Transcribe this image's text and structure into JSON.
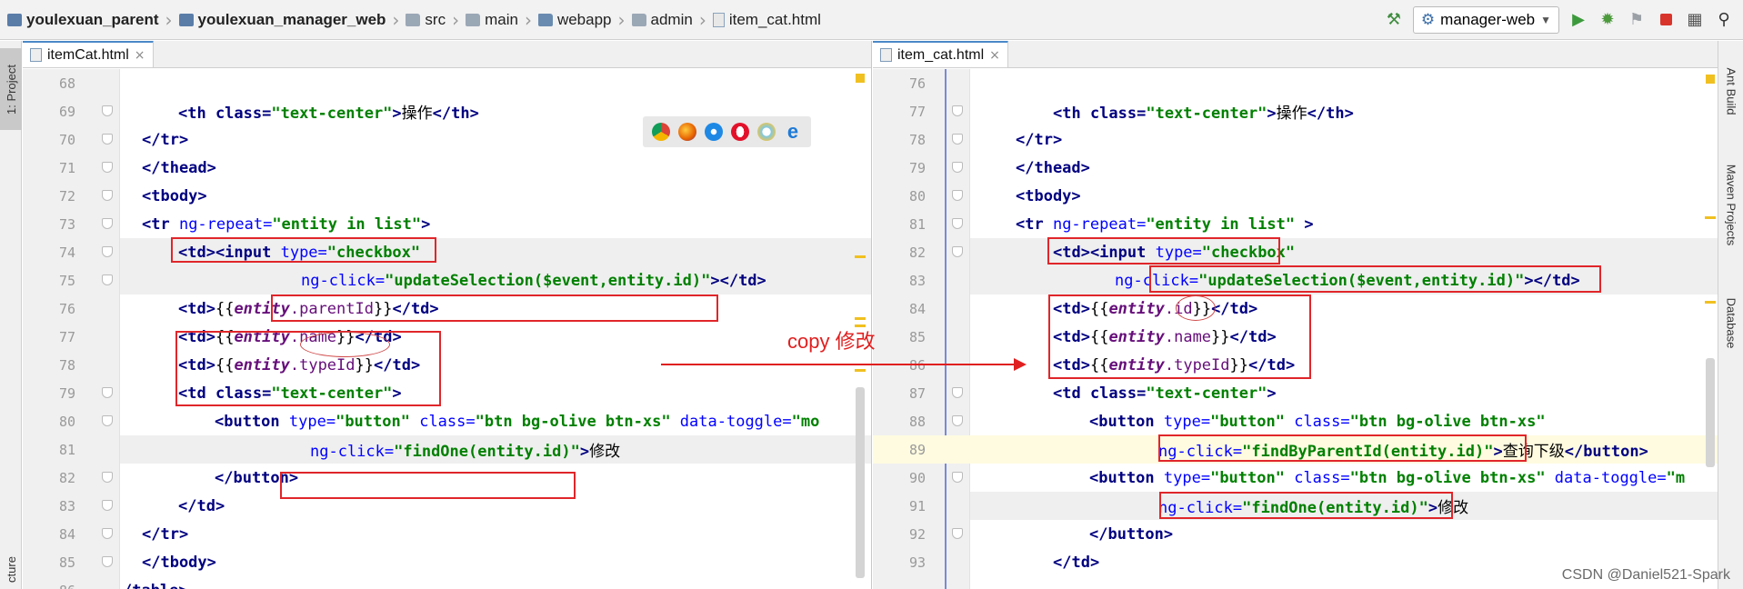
{
  "navbar": {
    "crumbs": [
      "youlexuan_parent",
      "youlexuan_manager_web",
      "src",
      "main",
      "webapp",
      "admin",
      "item_cat.html"
    ],
    "run_config": "manager-web"
  },
  "left_strip": {
    "project_tab": "1: Project",
    "structure_tab": "cture"
  },
  "right_strip": {
    "ant_tab": "Ant Build",
    "maven_tab": "Maven Projects",
    "database_tab": "Database"
  },
  "left_pane": {
    "tab_label": "itemCat.html",
    "line_numbers": [
      "68",
      "69",
      "70",
      "71",
      "72",
      "73",
      "74",
      "75",
      "76",
      "77",
      "78",
      "79",
      "80",
      "81",
      "82",
      "83",
      "84",
      "85",
      "86"
    ],
    "lines": {
      "l69_a": "<th class=",
      "l69_b": "\"text-center\"",
      "l69_c": ">",
      "l69_d": "操作",
      "l69_e": "</th>",
      "l70": "</tr>",
      "l71": "</thead>",
      "l72": "<tbody>",
      "l73_a": "<tr ",
      "l73_b": "ng-repeat=",
      "l73_c": "\"entity in list\"",
      "l73_d": ">",
      "l74_a": "<td><input ",
      "l74_b": "type=",
      "l74_c": "\"checkbox\"",
      "l75_a": "ng-click=",
      "l75_b": "\"updateSelection($event,entity.id)\"",
      "l75_c": "></td>",
      "l76_a": "<td>",
      "l76_b": "{{",
      "l76_c": "entity",
      "l76_d": ".parentId",
      "l76_e": "}}",
      "l76_f": "</td>",
      "l77_a": "<td>",
      "l77_b": "{{",
      "l77_c": "entity",
      "l77_d": ".name",
      "l77_e": "}}",
      "l77_f": "</td>",
      "l78_a": "<td>",
      "l78_b": "{{",
      "l78_c": "entity",
      "l78_d": ".typeId",
      "l78_e": "}}",
      "l78_f": "</td>",
      "l79_a": "<td class=",
      "l79_b": "\"text-center\"",
      "l79_c": ">",
      "l80_a": "<button ",
      "l80_b": "type=",
      "l80_c": "\"button\"",
      "l80_d": " class=",
      "l80_e": "\"btn bg-olive btn-xs\"",
      "l80_f": " data-toggle=",
      "l80_g": "\"mo",
      "l81_a": "ng-click=",
      "l81_b": "\"findOne(entity.id)\"",
      "l81_c": ">",
      "l81_d": "修改",
      "l82": "</button>",
      "l83": "</td>",
      "l84": "</tr>",
      "l85": "</tbody>",
      "l86": "/table>"
    }
  },
  "right_pane": {
    "tab_label": "item_cat.html",
    "line_numbers": [
      "76",
      "77",
      "78",
      "79",
      "80",
      "81",
      "82",
      "83",
      "84",
      "85",
      "86",
      "87",
      "88",
      "89",
      "90",
      "91",
      "92",
      "93"
    ],
    "lines": {
      "r77_a": "<th class=",
      "r77_b": "\"text-center\"",
      "r77_c": ">",
      "r77_d": "操作",
      "r77_e": "</th>",
      "r78": "</tr>",
      "r79": "</thead>",
      "r80": "<tbody>",
      "r81_a": "<tr ",
      "r81_b": "ng-repeat=",
      "r81_c": "\"entity in list\"",
      "r81_d": " >",
      "r82_a": "<td><input ",
      "r82_b": "type=",
      "r82_c": "\"checkbox\"",
      "r83_a": "ng-click=",
      "r83_b": "\"updateSelection($event,entity.id)\"",
      "r83_c": "></td>",
      "r84_a": "<td>",
      "r84_b": "{{",
      "r84_c": "entity",
      "r84_d": ".id",
      "r84_e": "}}",
      "r84_f": "</td>",
      "r85_a": "<td>",
      "r85_b": "{{",
      "r85_c": "entity",
      "r85_d": ".name",
      "r85_e": "}}",
      "r85_f": "</td>",
      "r86_a": "<td>",
      "r86_b": "{{",
      "r86_c": "entity",
      "r86_d": ".typeId",
      "r86_e": "}}",
      "r86_f": "</td>",
      "r87_a": "<td class=",
      "r87_b": "\"text-center\"",
      "r87_c": ">",
      "r88_a": "<button ",
      "r88_b": "type=",
      "r88_c": "\"button\"",
      "r88_d": " class=",
      "r88_e": "\"btn bg-olive btn-xs\"",
      "r89_a": "ng-click=",
      "r89_b": "\"findByParentId(entity.id)\"",
      "r89_c": ">",
      "r89_d": "查询下级",
      "r89_e": "</button>",
      "r90_a": "<button ",
      "r90_b": "type=",
      "r90_c": "\"button\"",
      "r90_d": " class=",
      "r90_e": "\"btn bg-olive btn-xs\"",
      "r90_f": " data-toggle=",
      "r90_g": "\"m",
      "r91_a": "ng-click=",
      "r91_b": "\"findOne(entity.id)\"",
      "r91_c": ">",
      "r91_d": "修改",
      "r92": "</button>",
      "r93": "</td>"
    }
  },
  "annotation": {
    "text": "copy 修改",
    "color": "#e02020"
  },
  "watermark": "CSDN @Daniel521-Spark",
  "colors": {
    "tag": "#000080",
    "attr": "#0000ff",
    "string": "#008000",
    "interp": "#660e7a",
    "redbox": "#e0262a",
    "tab_accent": "#4a88c7"
  },
  "icons": [
    "module-icon",
    "folder-icon",
    "html-file-icon",
    "hammer-icon",
    "gear-icon",
    "run-icon",
    "debug-icon",
    "coverage-icon",
    "stop-icon",
    "project-structure-icon",
    "search-icon",
    "chrome-icon",
    "firefox-icon",
    "safari-icon",
    "opera-icon",
    "ie-icon",
    "edge-icon"
  ]
}
